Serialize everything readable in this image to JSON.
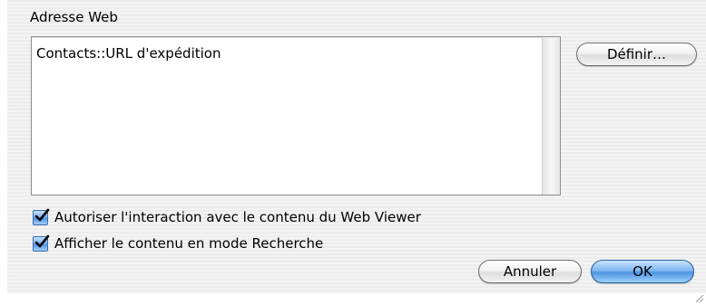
{
  "dialog": {
    "section_label": "Adresse Web",
    "url_field": {
      "value": "Contacts::URL d'expédition"
    },
    "define_button_label": "Définir…",
    "checkboxes": [
      {
        "label": "Autoriser l'interaction avec le contenu du Web Viewer",
        "checked": true
      },
      {
        "label": "Afficher le contenu en mode Recherche",
        "checked": true
      }
    ],
    "cancel_button_label": "Annuler",
    "ok_button_label": "OK"
  },
  "colors": {
    "dialog_background": "#ededed",
    "primary_button": "#6aa8ee",
    "checkbox_fill": "#5a98e6"
  },
  "icons": {
    "checkbox_mark": "checkmark-icon",
    "resize": "resize-grip-icon"
  }
}
